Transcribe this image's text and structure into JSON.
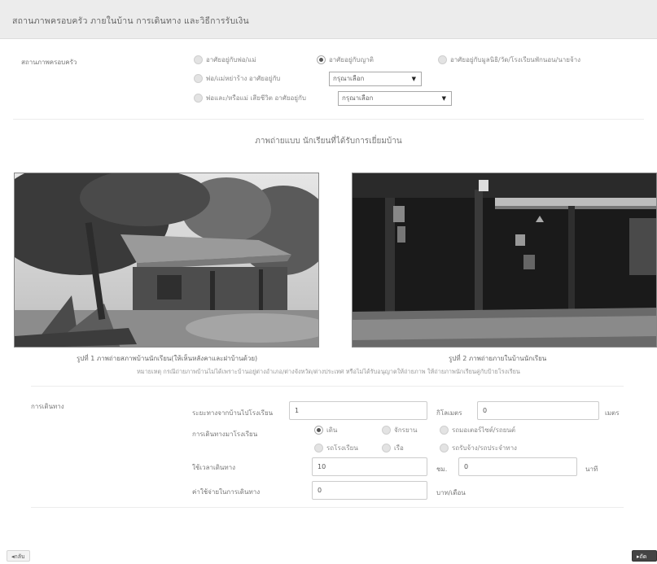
{
  "header": {
    "title": "สถานภาพครอบครัว ภายในบ้าน การเดินทาง และวิธีการรับเงิน"
  },
  "family": {
    "label": "สถานภาพครอบครัว",
    "options": [
      {
        "label": "อาศัยอยู่กับพ่อ/แม่",
        "checked": false
      },
      {
        "label": "อาศัยอยู่กับญาติ",
        "checked": true
      },
      {
        "label": "อาศัยอยู่กับมูลนิธิ/วัด/โรงเรียนพักนอน/นายจ้าง",
        "checked": false
      },
      {
        "label": "พ่อ/แม่หย่าร้าง อาศัยอยู่กับ",
        "checked": false
      },
      {
        "label": "พ่อและ/หรือแม่ เสียชีวิต อาศัยอยู่กับ",
        "checked": false
      }
    ],
    "select_placeholder_1": "กรุณาเลือก",
    "select_placeholder_2": "กรุณาเลือก"
  },
  "photos": {
    "section_title": "ภาพถ่ายแบบ นักเรียนที่ได้รับการเยี่ยมบ้าน",
    "caption_1": "รูปที่ 1 ภาพถ่ายสภาพบ้านนักเรียน(ให้เห็นหลังคาและฝาบ้านด้วย)",
    "caption_2": "รูปที่ 2 ภาพถ่ายภายในบ้านนักเรียน",
    "note": "หมายเหตุ กรณีถ่ายภาพบ้านไม่ได้เพราะบ้านอยู่ต่างอำเภอ/ต่างจังหวัด/ต่างประเทศ หรือไม่ได้รับอนุญาตให้ถ่ายภาพ ให้ถ่ายภาพนักเรียนคู่กับป้ายโรงเรียน"
  },
  "travel": {
    "label": "การเดินทาง",
    "distance_label": "ระยะทางจากบ้านไปโรงเรียน",
    "distance_km": "1",
    "km_unit": "กิโลเมตร",
    "distance_m": "0",
    "m_unit": "เมตร",
    "method_label": "การเดินทางมาโรงเรียน",
    "methods": [
      {
        "label": "เดิน",
        "checked": true
      },
      {
        "label": "จักรยาน",
        "checked": false
      },
      {
        "label": "รถมอเตอร์ไซต์/รถยนต์",
        "checked": false
      },
      {
        "label": "รถโรงเรียน",
        "checked": false
      },
      {
        "label": "เรือ",
        "checked": false
      },
      {
        "label": "รถรับจ้าง/รถประจำทาง",
        "checked": false
      }
    ],
    "time_label": "ใช้เวลาเดินทาง",
    "time_hours": "10",
    "hour_unit": "ชม.",
    "time_minutes": "0",
    "minute_unit": "นาที",
    "cost_label": "ค่าใช้จ่ายในการเดินทาง",
    "cost": "0",
    "cost_unit": "บาท/เดือน"
  },
  "nav": {
    "back_label": "◂กลับ",
    "next_label": "▸ถัดไป"
  }
}
